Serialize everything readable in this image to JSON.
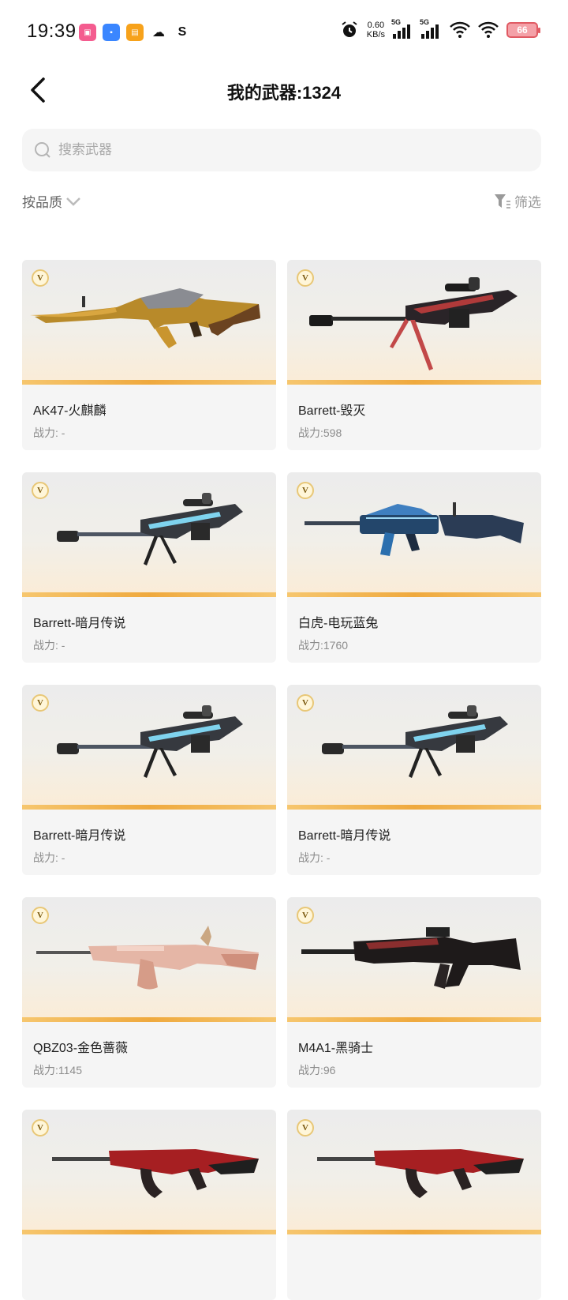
{
  "status_bar": {
    "time": "19:39",
    "net_speed_value": "0.60",
    "net_speed_unit": "KB/s",
    "sim1": "5G",
    "sim2": "5G",
    "battery": "66"
  },
  "header": {
    "title": "我的武器:1324"
  },
  "search": {
    "placeholder": "搜索武器"
  },
  "toolbar": {
    "sort_label": "按品质",
    "filter_label": "筛选"
  },
  "weapons": [
    {
      "badge": "V",
      "name": "AK47-火麒麟",
      "power": "战力: -",
      "gun": "ak-gold"
    },
    {
      "badge": "V",
      "name": "Barrett-毁灭",
      "power": "战力:598",
      "gun": "barrett-dark"
    },
    {
      "badge": "V",
      "name": "Barrett-暗月传说",
      "power": "战力: -",
      "gun": "barrett-blue"
    },
    {
      "badge": "V",
      "name": "白虎-电玩蓝兔",
      "power": "战力:1760",
      "gun": "rifle-blue"
    },
    {
      "badge": "V",
      "name": "Barrett-暗月传说",
      "power": "战力: -",
      "gun": "barrett-blue"
    },
    {
      "badge": "V",
      "name": "Barrett-暗月传说",
      "power": "战力: -",
      "gun": "barrett-blue"
    },
    {
      "badge": "V",
      "name": "QBZ03-金色蔷薇",
      "power": "战力:1145",
      "gun": "qbz-rose"
    },
    {
      "badge": "V",
      "name": "M4A1-黑骑士",
      "power": "战力:96",
      "gun": "m4-black"
    },
    {
      "badge": "V",
      "name": "",
      "power": "",
      "gun": "ak-red"
    },
    {
      "badge": "V",
      "name": "",
      "power": "",
      "gun": "ak-red"
    }
  ],
  "colors": {
    "accent_bar": "#efa93e",
    "card_bg": "#f5f5f5"
  }
}
